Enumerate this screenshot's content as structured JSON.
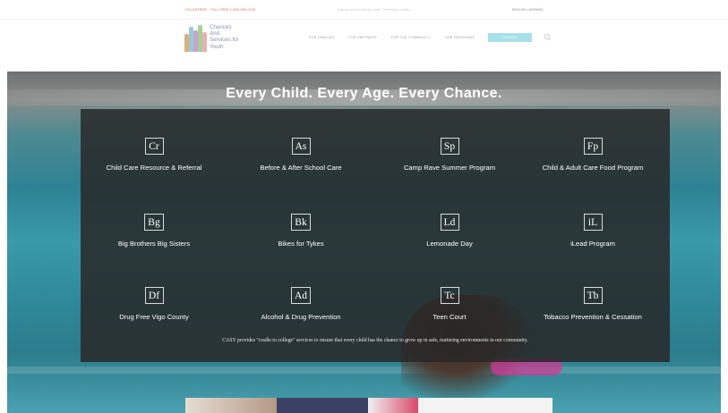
{
  "topbar": {
    "left_text": "VOLUNTEER · TOLL FREE 1-800-555-0199",
    "address_text": "Chances And Services for Youth · Terre Haute, Indiana",
    "language_text": "ENGLISH | ESPAÑOL"
  },
  "header": {
    "logo_text": "Chances\nAnd\nServices for\nYouth",
    "nav": [
      "FOR FAMILIES",
      "FOR PARTNERS",
      "FOR THE COMMUNITY",
      "OUR PROGRAMS"
    ],
    "donate_label": "DONATE"
  },
  "hero": {
    "title": "Every Child. Every Age. Every Chance."
  },
  "services": [
    {
      "abbr": "Cr",
      "label": "Child Care Resource & Referral"
    },
    {
      "abbr": "As",
      "label": "Before & After School Care"
    },
    {
      "abbr": "Sp",
      "label": "Camp Rave Summer Program"
    },
    {
      "abbr": "Fp",
      "label": "Child & Adult Care Food Program"
    },
    {
      "abbr": "Bg",
      "label": "Big Brothers Big Sisters"
    },
    {
      "abbr": "Bk",
      "label": "Bikes for Tykes"
    },
    {
      "abbr": "Ld",
      "label": "Lemonade Day"
    },
    {
      "abbr": "iL",
      "label": "iLead Program"
    },
    {
      "abbr": "Df",
      "label": "Drug Free Vigo County"
    },
    {
      "abbr": "Ad",
      "label": "Alcohol & Drug Prevention"
    },
    {
      "abbr": "Tc",
      "label": "Teen Court"
    },
    {
      "abbr": "Tb",
      "label": "Tobacco Prevention & Cessation"
    }
  ],
  "tagline": "CASY provides \"cradle to college\" services to ensure that every child has the chance to grow up in safe, nurturing environments in our community.",
  "colors": {
    "donate": "#a7e0ea",
    "panel": "#282828",
    "topbar_accent": "#e45b5b",
    "logo_text": "#8c8fb5",
    "card_dark": "#3b4165"
  },
  "icons": {
    "search": "search-icon",
    "logo": "logo-figures-icon"
  }
}
